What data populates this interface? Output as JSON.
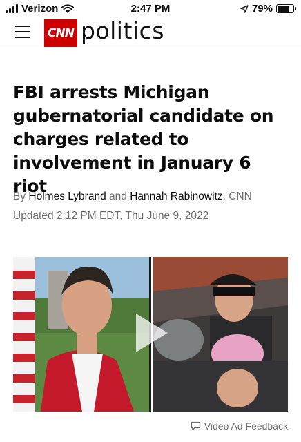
{
  "status_bar": {
    "carrier": "Verizon",
    "time": "2:47 PM",
    "battery_percent_label": "79%",
    "battery_level": 0.79
  },
  "header": {
    "logo_text": "CNN",
    "section": "politics"
  },
  "article": {
    "headline": "FBI arrests Michigan gubernatorial candidate on charges related to involvement in January 6 riot",
    "byline_prefix": "By",
    "author_1": "Holmes Lybrand",
    "byline_and": "and",
    "author_2": "Hannah Rabinowitz",
    "byline_suffix": ", CNN",
    "updated": "Updated 2:12 PM EDT, Thu June 9, 2022"
  },
  "video": {
    "ad_feedback_label": "Video Ad Feedback"
  },
  "colors": {
    "cnn_red": "#cc0000",
    "text": "#0c0c0c",
    "meta_gray": "#6e6e6e"
  }
}
